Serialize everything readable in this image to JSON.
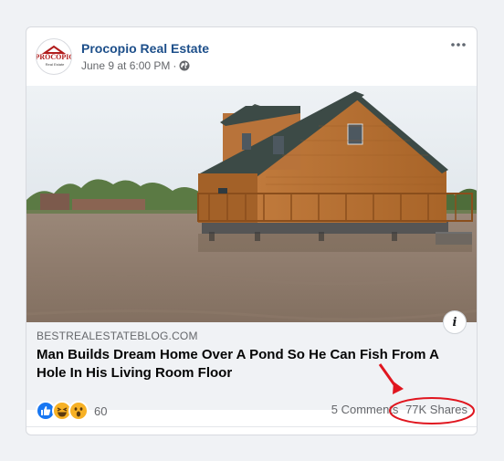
{
  "post": {
    "page_name": "Procopio Real Estate",
    "timestamp": "June 9 at 6:00 PM",
    "separator": "·",
    "privacy_icon": "globe-icon",
    "avatar_text": "PROCOPIO",
    "avatar_subtext": "Real Estate"
  },
  "link": {
    "domain": "BESTREALESTATEBLOG.COM",
    "headline": "Man Builds Dream Home Over A Pond So He Can Fish From A Hole In His Living Room Floor",
    "info_label": "i"
  },
  "footer": {
    "reaction_icons": [
      "like-icon",
      "haha-icon",
      "wow-icon"
    ],
    "reaction_count": "60",
    "comments": "5 Comments",
    "shares": "77K Shares"
  },
  "colors": {
    "page_name": "#1d4f8a",
    "annotation": "#e0161f",
    "like": "#1877f2",
    "emoji": "#f7b125"
  }
}
